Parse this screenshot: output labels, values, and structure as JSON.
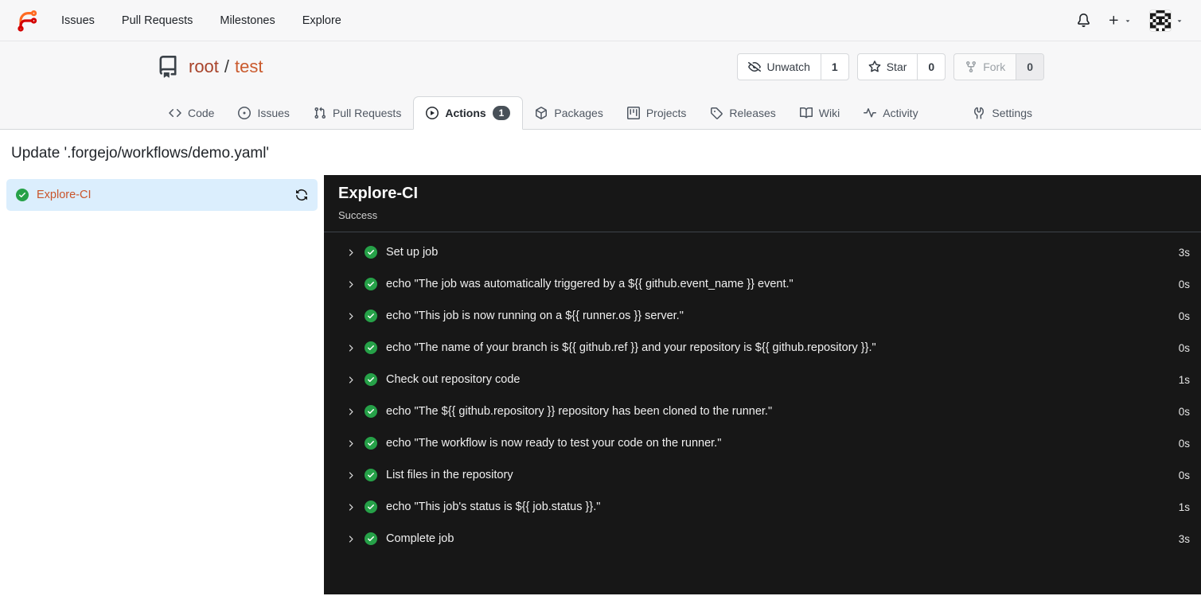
{
  "topnav": {
    "items": [
      {
        "label": "Issues"
      },
      {
        "label": "Pull Requests"
      },
      {
        "label": "Milestones"
      },
      {
        "label": "Explore"
      }
    ]
  },
  "repo_header": {
    "owner": "root",
    "separator": "/",
    "name": "test",
    "watch": {
      "label": "Unwatch",
      "count": "1"
    },
    "star": {
      "label": "Star",
      "count": "0"
    },
    "fork": {
      "label": "Fork",
      "count": "0"
    }
  },
  "tabs": {
    "items": [
      {
        "label": "Code"
      },
      {
        "label": "Issues"
      },
      {
        "label": "Pull Requests"
      },
      {
        "label": "Actions"
      },
      {
        "label": "Packages"
      },
      {
        "label": "Projects"
      },
      {
        "label": "Releases"
      },
      {
        "label": "Wiki"
      },
      {
        "label": "Activity"
      },
      {
        "label": "Settings"
      }
    ],
    "active_tab": "Actions",
    "actions_count": "1"
  },
  "page": {
    "title": "Update '.forgejo/workflows/demo.yaml'"
  },
  "sidebar": {
    "job": {
      "name": "Explore-CI",
      "status": "success"
    }
  },
  "run": {
    "title": "Explore-CI",
    "status": "Success",
    "steps": [
      {
        "label": "Set up job",
        "duration": "3s"
      },
      {
        "label": "echo \"The job was automatically triggered by a ${{ github.event_name }} event.\"",
        "duration": "0s"
      },
      {
        "label": "echo \"This job is now running on a ${{ runner.os }} server.\"",
        "duration": "0s"
      },
      {
        "label": "echo \"The name of your branch is ${{ github.ref }} and your repository is ${{ github.repository }}.\"",
        "duration": "0s"
      },
      {
        "label": "Check out repository code",
        "duration": "1s"
      },
      {
        "label": "echo \"The ${{ github.repository }} repository has been cloned to the runner.\"",
        "duration": "0s"
      },
      {
        "label": "echo \"The workflow is now ready to test your code on the runner.\"",
        "duration": "0s"
      },
      {
        "label": "List files in the repository",
        "duration": "0s"
      },
      {
        "label": "echo \"This job's status is ${{ job.status }}.\"",
        "duration": "1s"
      },
      {
        "label": "Complete job",
        "duration": "3s"
      }
    ]
  },
  "colors": {
    "primary_link": "#c9542a",
    "success_green": "#26a148",
    "panel_background": "#171717",
    "selected_job_background": "#dbeefd",
    "badge_background": "#485058",
    "header_background": "#f7f7f8"
  }
}
